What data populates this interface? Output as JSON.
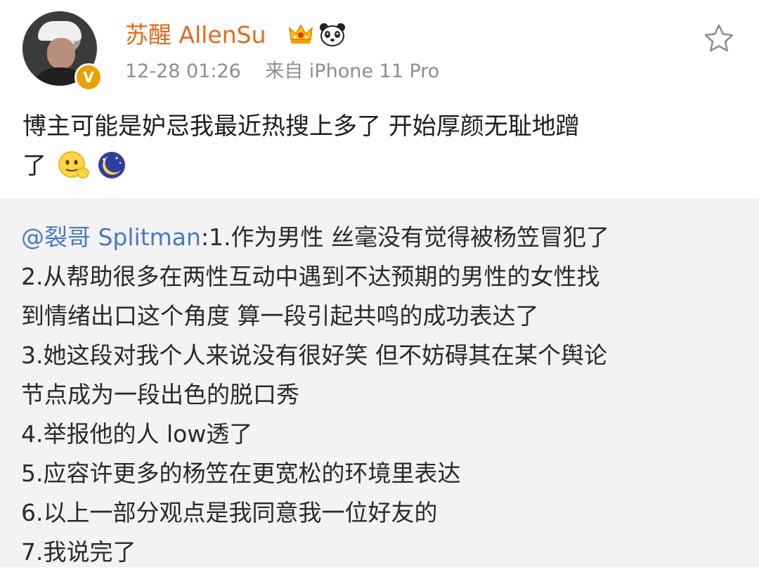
{
  "post": {
    "username": "苏醒 AllenSu",
    "timestamp": "12-28 01:26",
    "source": "来自 iPhone 11 Pro",
    "badge": "V",
    "content_line1": "博主可能是妒忌我最近热搜上多了 开始厚颜无耻地蹭",
    "content_line2": "了",
    "icons": [
      "crown-icon",
      "panda-icon",
      "star-icon",
      "thinking-emoji-icon",
      "moon-emoji-icon"
    ]
  },
  "repost": {
    "mention": "@裂哥 Splitman",
    "lines": [
      ":1.作为男性 丝毫没有觉得被杨笠冒犯了",
      "2.从帮助很多在两性互动中遇到不达预期的男性的女性找",
      "到情绪出口这个角度 算一段引起共鸣的成功表达了",
      "3.她这段对我个人来说没有很好笑 但不妨碍其在某个舆论",
      "节点成为一段出色的脱口秀",
      "4.举报他的人 low透了",
      "5.应容许更多的杨笠在更宽松的环境里表达",
      "6.以上一部分观点是我同意我一位好友的",
      "7.我说完了"
    ]
  },
  "colors": {
    "username": "#e36a1d",
    "mention": "#4a79c7",
    "meta": "#8e8e8e",
    "repost_background": "#f3f3f3"
  }
}
